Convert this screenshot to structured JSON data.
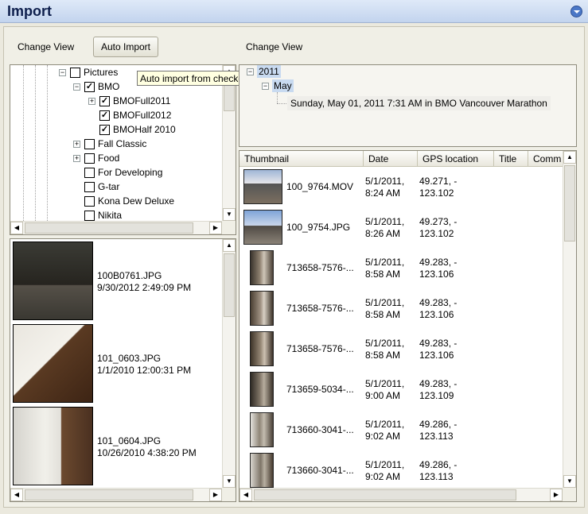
{
  "header": {
    "title": "Import"
  },
  "left_toolbar": {
    "change_view": "Change View",
    "auto_import": "Auto Import"
  },
  "right_toolbar": {
    "change_view": "Change View"
  },
  "tooltip": "Auto import from checked folders",
  "folder_tree": [
    {
      "label": "Pictures",
      "checked": false,
      "expander": "−"
    },
    {
      "label": "BMO",
      "checked": true,
      "expander": "−"
    },
    {
      "label": "BMOFull2011",
      "checked": true,
      "expander": "+"
    },
    {
      "label": "BMOFull2012",
      "checked": true,
      "expander": ""
    },
    {
      "label": "BMOHalf 2010",
      "checked": true,
      "expander": ""
    },
    {
      "label": "Fall Classic",
      "checked": false,
      "expander": "+"
    },
    {
      "label": "Food",
      "checked": false,
      "expander": "+"
    },
    {
      "label": "For Developing",
      "checked": false,
      "expander": ""
    },
    {
      "label": "G-tar",
      "checked": false,
      "expander": ""
    },
    {
      "label": "Kona Dew Deluxe",
      "checked": false,
      "expander": ""
    },
    {
      "label": "Nikita",
      "checked": false,
      "expander": ""
    }
  ],
  "date_tree": {
    "year": "2011",
    "month": "May",
    "event": "Sunday, May 01, 2011 7:31 AM in BMO Vancouver Marathon"
  },
  "photos": [
    {
      "name": "100B0761.JPG",
      "datetime": "9/30/2012 2:49:09 PM"
    },
    {
      "name": "101_0603.JPG",
      "datetime": "1/1/2010 12:00:31 PM"
    },
    {
      "name": "101_0604.JPG",
      "datetime": "10/26/2010 4:38:20 PM"
    }
  ],
  "table": {
    "columns": [
      "Thumbnail",
      "Date",
      "GPS location",
      "Title",
      "Comm"
    ],
    "rows": [
      {
        "file": "100_9764.MOV",
        "date1": "5/1/2011,",
        "date2": "8:24 AM",
        "gps1": "49.271, -",
        "gps2": "123.102"
      },
      {
        "file": "100_9754.JPG",
        "date1": "5/1/2011,",
        "date2": "8:26 AM",
        "gps1": "49.273, -",
        "gps2": "123.102"
      },
      {
        "file": "713658-7576-...",
        "date1": "5/1/2011,",
        "date2": "8:58 AM",
        "gps1": "49.283, -",
        "gps2": "123.106"
      },
      {
        "file": "713658-7576-...",
        "date1": "5/1/2011,",
        "date2": "8:58 AM",
        "gps1": "49.283, -",
        "gps2": "123.106"
      },
      {
        "file": "713658-7576-...",
        "date1": "5/1/2011,",
        "date2": "8:58 AM",
        "gps1": "49.283, -",
        "gps2": "123.106"
      },
      {
        "file": "713659-5034-...",
        "date1": "5/1/2011,",
        "date2": "9:00 AM",
        "gps1": "49.283, -",
        "gps2": "123.109"
      },
      {
        "file": "713660-3041-...",
        "date1": "5/1/2011,",
        "date2": "9:02 AM",
        "gps1": "49.286, -",
        "gps2": "123.113"
      },
      {
        "file": "713660-3041-...",
        "date1": "5/1/2011,",
        "date2": "9:02 AM",
        "gps1": "49.286, -",
        "gps2": "123.113"
      }
    ]
  },
  "colors": {
    "title_bar": "#c3d4ee",
    "title_text": "#0e1f4d",
    "panel_bg": "#f0efe6",
    "selection": "#c8daf0",
    "tooltip_bg": "#ffffe1"
  },
  "icons": {
    "collapse": "chevron-down-icon",
    "scroll_up": "arrow-up-icon",
    "scroll_down": "arrow-down-icon",
    "scroll_left": "arrow-left-icon",
    "scroll_right": "arrow-right-icon"
  }
}
